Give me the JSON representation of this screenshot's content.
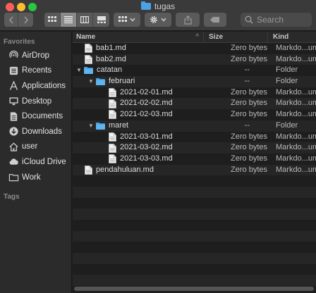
{
  "window": {
    "title": "tugas"
  },
  "toolbar": {
    "search_placeholder": "Search"
  },
  "sidebar": {
    "favorites_heading": "Favorites",
    "tags_heading": "Tags",
    "items": [
      {
        "label": "AirDrop",
        "icon": "airdrop-icon"
      },
      {
        "label": "Recents",
        "icon": "recents-icon"
      },
      {
        "label": "Applications",
        "icon": "applications-icon"
      },
      {
        "label": "Desktop",
        "icon": "desktop-icon"
      },
      {
        "label": "Documents",
        "icon": "documents-icon"
      },
      {
        "label": "Downloads",
        "icon": "downloads-icon"
      },
      {
        "label": "user",
        "icon": "home-icon"
      },
      {
        "label": "iCloud Drive",
        "icon": "icloud-icon"
      },
      {
        "label": "Work",
        "icon": "folder-icon"
      }
    ]
  },
  "columns": {
    "name": "Name",
    "size": "Size",
    "kind": "Kind"
  },
  "files": [
    {
      "name": "bab1.md",
      "size": "Zero bytes",
      "kind": "Markdo...ument",
      "type": "file",
      "depth": 0
    },
    {
      "name": "bab2.md",
      "size": "Zero bytes",
      "kind": "Markdo...ument",
      "type": "file",
      "depth": 0
    },
    {
      "name": "catatan",
      "size": "--",
      "kind": "Folder",
      "type": "folder",
      "depth": 0,
      "expanded": true
    },
    {
      "name": "februari",
      "size": "--",
      "kind": "Folder",
      "type": "folder",
      "depth": 1,
      "expanded": true
    },
    {
      "name": "2021-02-01.md",
      "size": "Zero bytes",
      "kind": "Markdo...ument",
      "type": "file",
      "depth": 2
    },
    {
      "name": "2021-02-02.md",
      "size": "Zero bytes",
      "kind": "Markdo...ument",
      "type": "file",
      "depth": 2
    },
    {
      "name": "2021-02-03.md",
      "size": "Zero bytes",
      "kind": "Markdo...ument",
      "type": "file",
      "depth": 2
    },
    {
      "name": "maret",
      "size": "--",
      "kind": "Folder",
      "type": "folder",
      "depth": 1,
      "expanded": true
    },
    {
      "name": "2021-03-01.md",
      "size": "Zero bytes",
      "kind": "Markdo...ument",
      "type": "file",
      "depth": 2
    },
    {
      "name": "2021-03-02.md",
      "size": "Zero bytes",
      "kind": "Markdo...ument",
      "type": "file",
      "depth": 2
    },
    {
      "name": "2021-03-03.md",
      "size": "Zero bytes",
      "kind": "Markdo...ument",
      "type": "file",
      "depth": 2
    },
    {
      "name": "pendahuluan.md",
      "size": "Zero bytes",
      "kind": "Markdo...ument",
      "type": "file",
      "depth": 0
    }
  ],
  "colors": {
    "folder": "#4aa3e6",
    "window_bg": "#1e1e1e",
    "sidebar_bg": "#2b2b2b",
    "toolbar_bg": "#3a3a3a"
  }
}
